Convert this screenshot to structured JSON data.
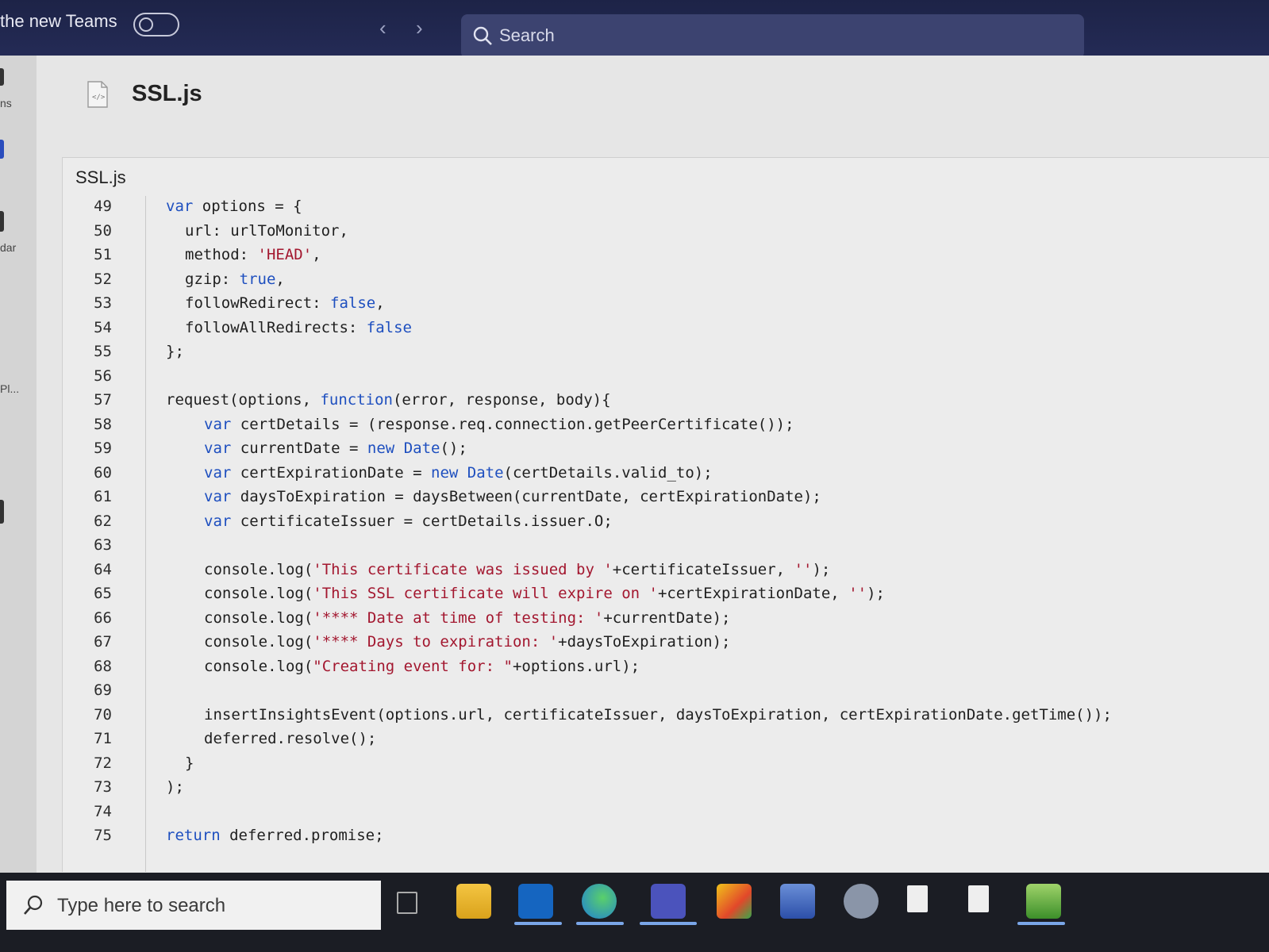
{
  "titlebar": {
    "new_teams_label": "the new Teams",
    "back_icon": "chevron-left-icon",
    "forward_icon": "chevron-right-icon",
    "search_placeholder": "Search",
    "search_icon": "search-icon"
  },
  "leftrail": {
    "labels": [
      "ns",
      "dar",
      "Pl..."
    ]
  },
  "file": {
    "title": "SSL.js",
    "tab_label": "SSL.js",
    "icon": "code-file-icon"
  },
  "code": {
    "lines": [
      {
        "num": "49",
        "text": "var options = {"
      },
      {
        "num": "50",
        "text": "url: urlToMonitor,"
      },
      {
        "num": "51",
        "text": "method: 'HEAD',"
      },
      {
        "num": "52",
        "text": "gzip: true,"
      },
      {
        "num": "53",
        "text": "followRedirect: false,"
      },
      {
        "num": "54",
        "text": "followAllRedirects: false"
      },
      {
        "num": "55",
        "text": "};"
      },
      {
        "num": "56",
        "text": ""
      },
      {
        "num": "57",
        "text": "request(options, function(error, response, body){"
      },
      {
        "num": "58",
        "text": "var certDetails = (response.req.connection.getPeerCertificate());"
      },
      {
        "num": "59",
        "text": "var currentDate = new Date();"
      },
      {
        "num": "60",
        "text": "var certExpirationDate = new Date(certDetails.valid_to);"
      },
      {
        "num": "61",
        "text": "var daysToExpiration = daysBetween(currentDate, certExpirationDate);"
      },
      {
        "num": "62",
        "text": "var certificateIssuer = certDetails.issuer.O;"
      },
      {
        "num": "63",
        "text": ""
      },
      {
        "num": "64",
        "text": "console.log('This certificate was issued by '+certificateIssuer, '');"
      },
      {
        "num": "65",
        "text": "console.log('This SSL certificate will expire on '+certExpirationDate, '');"
      },
      {
        "num": "66",
        "text": "console.log('**** Date at time of testing: '+currentDate);"
      },
      {
        "num": "67",
        "text": "console.log('**** Days to expiration: '+daysToExpiration);"
      },
      {
        "num": "68",
        "text": "console.log(\"Creating event for: \"+options.url);"
      },
      {
        "num": "69",
        "text": ""
      },
      {
        "num": "70",
        "text": "insertInsightsEvent(options.url, certificateIssuer, daysToExpiration, certExpirationDate.getTime());"
      },
      {
        "num": "71",
        "text": "deferred.resolve();"
      },
      {
        "num": "72",
        "text": "}"
      },
      {
        "num": "73",
        "text": ");"
      },
      {
        "num": "74",
        "text": ""
      },
      {
        "num": "75",
        "text": "return deferred.promise;"
      }
    ]
  },
  "taskbar": {
    "search_placeholder": "Type here to search",
    "search_icon": "search-icon",
    "apps": [
      {
        "name": "task-view-icon"
      },
      {
        "name": "file-explorer-icon"
      },
      {
        "name": "outlook-icon"
      },
      {
        "name": "edge-icon"
      },
      {
        "name": "teams-icon"
      },
      {
        "name": "snipping-tool-icon"
      },
      {
        "name": "remote-desktop-icon"
      },
      {
        "name": "app-icon"
      },
      {
        "name": "document-icon"
      },
      {
        "name": "document-icon-2"
      },
      {
        "name": "notepad-icon"
      }
    ]
  },
  "colors": {
    "keyword": "#1e4fbf",
    "string": "#a3172f",
    "titlebar": "#262d5a"
  }
}
